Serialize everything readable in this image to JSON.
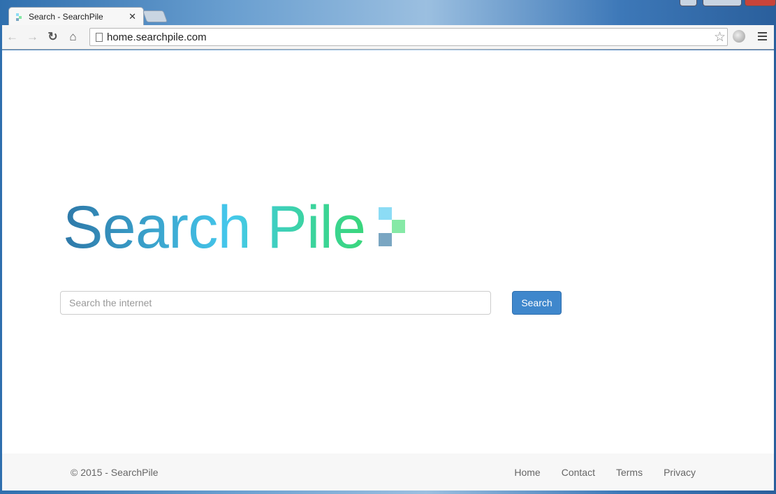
{
  "browser": {
    "tab_title": "Search - SearchPile",
    "url": "home.searchpile.com",
    "icons": [
      "back-icon",
      "forward-icon",
      "reload-icon",
      "home-icon",
      "page-icon",
      "star-icon",
      "globe-icon",
      "menu-icon"
    ]
  },
  "logo": {
    "text": "Search Pile",
    "colors": [
      "#2e78a8",
      "#45c8ec",
      "#3bd4a0",
      "#3ad67a"
    ],
    "squares": [
      "#8cdcf5",
      "#86e9a6",
      "#7aa6c2"
    ]
  },
  "search": {
    "placeholder": "Search the internet",
    "value": "",
    "button": "Search",
    "button_color": "#3f87cc"
  },
  "footer": {
    "copyright": "© 2015 - SearchPile",
    "links": [
      "Home",
      "Contact",
      "Terms",
      "Privacy"
    ]
  }
}
